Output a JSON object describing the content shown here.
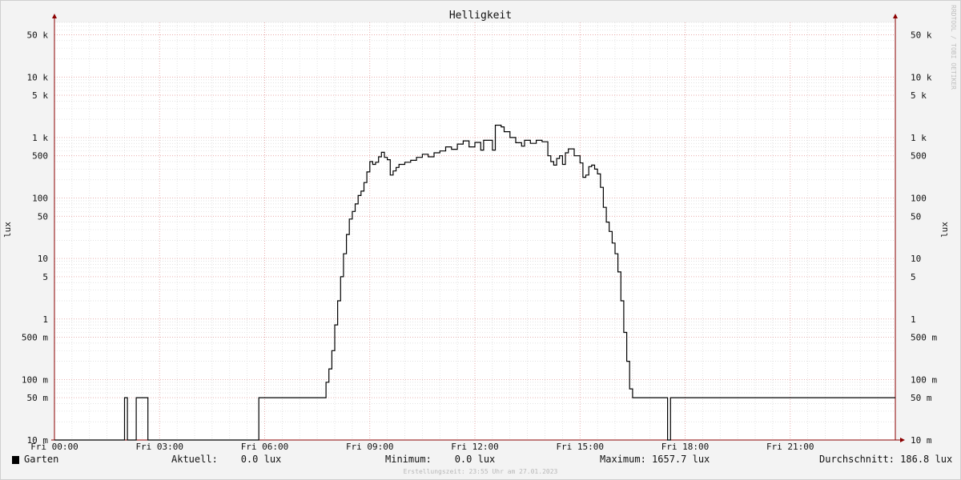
{
  "chart_data": {
    "type": "line",
    "title": "Helligkeit",
    "ylabel": "lux",
    "scale": "log",
    "ylim": [
      0.01,
      80000
    ],
    "xlim": [
      "Fri 00:00",
      "Fri 24:00"
    ],
    "xticks": [
      "Fri 00:00",
      "Fri 03:00",
      "Fri 06:00",
      "Fri 09:00",
      "Fri 12:00",
      "Fri 15:00",
      "Fri 18:00",
      "Fri 21:00"
    ],
    "yticks": [
      {
        "value": 0.01,
        "label": "10 m"
      },
      {
        "value": 0.05,
        "label": "50 m"
      },
      {
        "value": 0.1,
        "label": "100 m"
      },
      {
        "value": 0.5,
        "label": "500 m"
      },
      {
        "value": 1,
        "label": "1"
      },
      {
        "value": 5,
        "label": "5"
      },
      {
        "value": 10,
        "label": "10"
      },
      {
        "value": 50,
        "label": "50"
      },
      {
        "value": 100,
        "label": "100"
      },
      {
        "value": 500,
        "label": "500"
      },
      {
        "value": 1000,
        "label": "1 k"
      },
      {
        "value": 5000,
        "label": "5 k"
      },
      {
        "value": 10000,
        "label": "10 k"
      },
      {
        "value": 50000,
        "label": "50 k"
      }
    ],
    "grid": true,
    "series": [
      {
        "name": "Garten",
        "color": "#000000",
        "points": [
          [
            "00:00",
            0.01
          ],
          [
            "01:55",
            0.01
          ],
          [
            "02:00",
            0.05
          ],
          [
            "02:05",
            0.01
          ],
          [
            "02:15",
            0.01
          ],
          [
            "02:20",
            0.05
          ],
          [
            "02:35",
            0.05
          ],
          [
            "02:40",
            0.01
          ],
          [
            "05:45",
            0.01
          ],
          [
            "05:50",
            0.05
          ],
          [
            "07:40",
            0.05
          ],
          [
            "07:45",
            0.09
          ],
          [
            "07:50",
            0.15
          ],
          [
            "07:55",
            0.3
          ],
          [
            "08:00",
            0.8
          ],
          [
            "08:05",
            2
          ],
          [
            "08:10",
            5
          ],
          [
            "08:15",
            12
          ],
          [
            "08:20",
            25
          ],
          [
            "08:25",
            45
          ],
          [
            "08:30",
            60
          ],
          [
            "08:35",
            80
          ],
          [
            "08:40",
            110
          ],
          [
            "08:45",
            130
          ],
          [
            "08:50",
            180
          ],
          [
            "08:55",
            270
          ],
          [
            "09:00",
            400
          ],
          [
            "09:05",
            360
          ],
          [
            "09:10",
            390
          ],
          [
            "09:15",
            480
          ],
          [
            "09:20",
            570
          ],
          [
            "09:25",
            470
          ],
          [
            "09:30",
            430
          ],
          [
            "09:35",
            240
          ],
          [
            "09:40",
            280
          ],
          [
            "09:45",
            320
          ],
          [
            "09:50",
            360
          ],
          [
            "10:00",
            390
          ],
          [
            "10:10",
            420
          ],
          [
            "10:20",
            470
          ],
          [
            "10:30",
            530
          ],
          [
            "10:40",
            480
          ],
          [
            "10:50",
            560
          ],
          [
            "11:00",
            600
          ],
          [
            "11:10",
            700
          ],
          [
            "11:20",
            640
          ],
          [
            "11:30",
            780
          ],
          [
            "11:40",
            880
          ],
          [
            "11:50",
            700
          ],
          [
            "12:00",
            830
          ],
          [
            "12:10",
            620
          ],
          [
            "12:15",
            900
          ],
          [
            "12:25",
            900
          ],
          [
            "12:30",
            620
          ],
          [
            "12:35",
            1600
          ],
          [
            "12:45",
            1500
          ],
          [
            "12:50",
            1250
          ],
          [
            "13:00",
            1000
          ],
          [
            "13:10",
            820
          ],
          [
            "13:20",
            720
          ],
          [
            "13:25",
            900
          ],
          [
            "13:35",
            800
          ],
          [
            "13:45",
            900
          ],
          [
            "13:55",
            850
          ],
          [
            "14:05",
            500
          ],
          [
            "14:10",
            400
          ],
          [
            "14:15",
            350
          ],
          [
            "14:20",
            450
          ],
          [
            "14:25",
            500
          ],
          [
            "14:30",
            360
          ],
          [
            "14:35",
            560
          ],
          [
            "14:40",
            650
          ],
          [
            "14:50",
            500
          ],
          [
            "15:00",
            380
          ],
          [
            "15:05",
            220
          ],
          [
            "15:10",
            240
          ],
          [
            "15:15",
            330
          ],
          [
            "15:20",
            350
          ],
          [
            "15:25",
            300
          ],
          [
            "15:30",
            250
          ],
          [
            "15:35",
            150
          ],
          [
            "15:40",
            70
          ],
          [
            "15:45",
            40
          ],
          [
            "15:50",
            28
          ],
          [
            "15:55",
            18
          ],
          [
            "16:00",
            12
          ],
          [
            "16:05",
            6
          ],
          [
            "16:10",
            2
          ],
          [
            "16:15",
            0.6
          ],
          [
            "16:20",
            0.2
          ],
          [
            "16:25",
            0.07
          ],
          [
            "16:30",
            0.05
          ],
          [
            "17:25",
            0.05
          ],
          [
            "17:30",
            0.01
          ],
          [
            "17:35",
            0.05
          ],
          [
            "24:00",
            0.05
          ]
        ]
      }
    ]
  },
  "legend": {
    "series_label": "Garten",
    "current": "Aktuell:    0.0 lux",
    "minimum": "Minimum:    0.0 lux",
    "maximum": "Maximum: 1657.7 lux",
    "average": "Durchschnitt: 186.8 lux"
  },
  "footer": "Erstellungszeit: 23:55 Uhr am 27.01.2023",
  "watermark": "RRDTOOL / TOBI OETIKER",
  "colors": {
    "background": "#f3f3f3",
    "plot_background": "#ffffff",
    "minor_grid": "#d6d6d6",
    "major_grid": "#e8a0a0",
    "axis": "#8b0000",
    "line": "#000000"
  }
}
